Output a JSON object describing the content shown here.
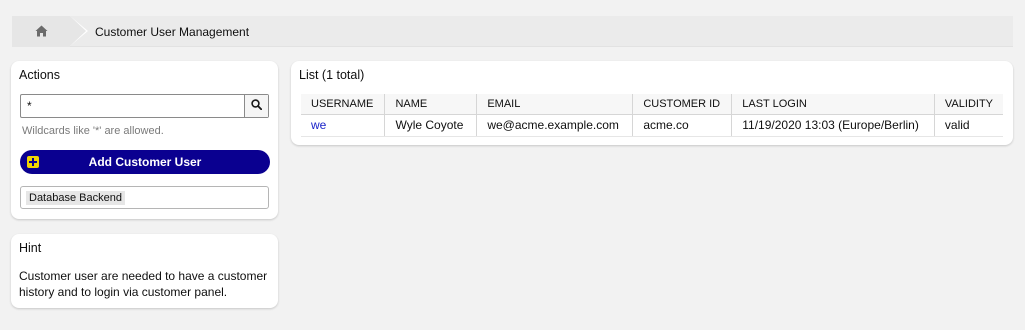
{
  "breadcrumb": {
    "home_icon": "home-icon",
    "title": "Customer User Management"
  },
  "actions": {
    "title": "Actions",
    "search": {
      "value": "*",
      "placeholder": ""
    },
    "wildcard_hint": "Wildcards like '*' are allowed.",
    "add_button": "Add Customer User",
    "backend_selected": "Database Backend"
  },
  "hint": {
    "title": "Hint",
    "text": "Customer user are needed to have a customer history and to login via customer panel."
  },
  "list": {
    "title": "List (1 total)",
    "columns": [
      "USERNAME",
      "NAME",
      "EMAIL",
      "CUSTOMER ID",
      "LAST LOGIN",
      "VALIDITY"
    ],
    "rows": [
      {
        "username": "we",
        "name": "Wyle Coyote",
        "email": "we@acme.example.com",
        "customer_id": "acme.co",
        "last_login": "11/19/2020 13:03 (Europe/Berlin)",
        "validity": "valid"
      }
    ]
  },
  "colors": {
    "accent": "#0a0090",
    "link": "#1a23c9",
    "plus_icon": "#f2d500"
  }
}
